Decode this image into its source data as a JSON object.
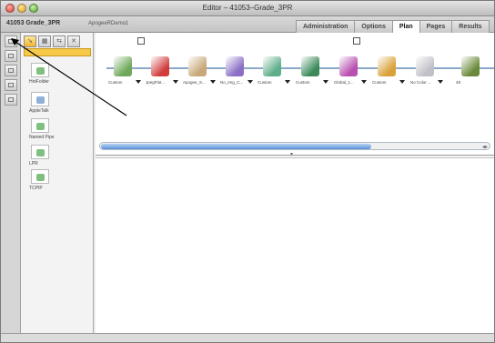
{
  "window": {
    "title": "Editor – 41053–Grade_3PR"
  },
  "header": {
    "job_name": "41053 Grade_3PR",
    "job_sub": "ApogeeRDemo1"
  },
  "tabs": [
    {
      "label": "Administration",
      "active": false
    },
    {
      "label": "Options",
      "active": false
    },
    {
      "label": "Plan",
      "active": true
    },
    {
      "label": "Pages",
      "active": false
    },
    {
      "label": "Results",
      "active": false
    }
  ],
  "resources": [
    {
      "label": "HotFolder",
      "color": "#7fbf7f"
    },
    {
      "label": "AppleTalk",
      "color": "#8fb0d8"
    },
    {
      "label": "Named Pipe",
      "color": "#7fbf7f"
    },
    {
      "label": "LPR",
      "color": "#7fbf7f"
    },
    {
      "label": "TCPIP",
      "color": "#7fbf7f"
    }
  ],
  "workflow_nodes": [
    {
      "label": "Custom",
      "color": "#6fa85a"
    },
    {
      "label": "JpegFlat...",
      "color": "#d23c3c"
    },
    {
      "label": "Apogee_S...",
      "color": "#c8a878"
    },
    {
      "label": "No_Img_C...",
      "color": "#8a6fc4"
    },
    {
      "label": "Custom",
      "color": "#5fae8a"
    },
    {
      "label": "Custom",
      "color": "#3c8a5a"
    },
    {
      "label": "Global_1...",
      "color": "#b94fb0"
    },
    {
      "label": "Custom",
      "color": "#d9a23a"
    },
    {
      "label": "No Color ...",
      "color": "#c0c0c8"
    },
    {
      "label": "48",
      "color": "#6a8a3a"
    }
  ],
  "colors": {
    "accent": "#f7c948",
    "scroll": "#5b92d9"
  }
}
